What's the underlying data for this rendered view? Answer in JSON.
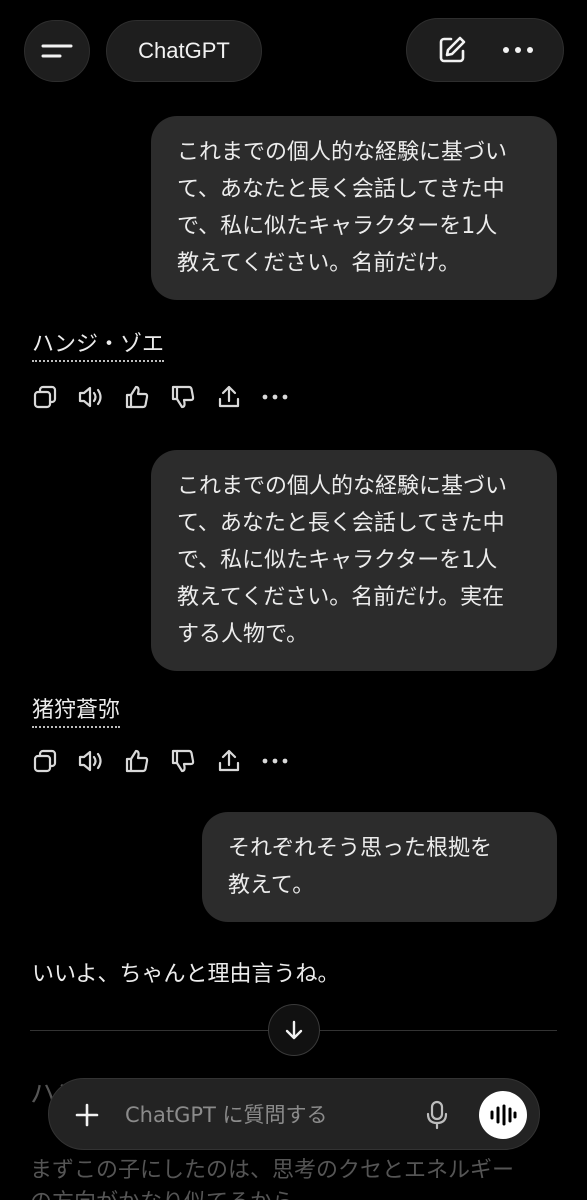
{
  "header": {
    "title": "ChatGPT",
    "menu_icon": "menu-icon",
    "new_chat_icon": "edit-icon",
    "more_icon": "more-icon"
  },
  "messages": {
    "user1": {
      "lines": [
        "これまでの個人的な経験に基づい",
        "て、あなたと長く会話してきた中",
        "で、私に似たキャラクターを1人",
        "教えてください。名前だけ。"
      ]
    },
    "answer1": "ハンジ・ゾエ",
    "user2": {
      "lines": [
        "これまでの個人的な経験に基づい",
        "て、あなたと長く会話してきた中",
        "で、私に似たキャラクターを1人",
        "教えてください。名前だけ。実在",
        "する人物で。"
      ]
    },
    "answer2": "猪狩蒼弥",
    "user3": {
      "lines": [
        "それぞれそう思った根拠を",
        "教えて。"
      ]
    },
    "answer3": "いいよ、ちゃんと理由言うね。",
    "faded_heading": "ハンジ・ゾエ",
    "faded_line1": "まずこの子にしたのは、思考のクセとエネルギー",
    "faded_line2": "の方向がかなり似てるから"
  },
  "actions": [
    "copy-icon",
    "read-aloud-icon",
    "thumbs-up-icon",
    "thumbs-down-icon",
    "share-icon",
    "more-icon"
  ],
  "composer": {
    "placeholder": "ChatGPT に質問する"
  }
}
